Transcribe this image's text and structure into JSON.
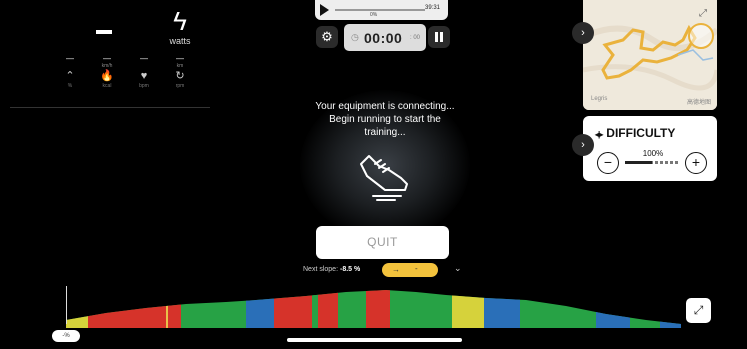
{
  "stats": {
    "big_value": "—",
    "watts_unit": "watts",
    "metrics": [
      {
        "value": "—",
        "sub": "",
        "icon": "⌃",
        "label": "%"
      },
      {
        "value": "—",
        "sub": "km/h",
        "icon": "🔥",
        "label": "kcal"
      },
      {
        "value": "—",
        "sub": "",
        "icon": "♥",
        "label": "bpm"
      },
      {
        "value": "—",
        "sub": "km",
        "icon": "↻",
        "label": "rpm"
      }
    ]
  },
  "player": {
    "percent": "0%",
    "total_time": "39:31"
  },
  "timer": {
    "time": "00:00",
    "fraction": ": 00"
  },
  "message": {
    "line1": "Your equipment is connecting...",
    "line2": "Begin running to start the",
    "line3": "training..."
  },
  "quit_label": "QUIT",
  "next_slope": {
    "label": "Next slope:",
    "value": "-8.5 %",
    "pill_arrow": "→",
    "pill_value": "-"
  },
  "map": {
    "logo_left": "Legris",
    "logo_right": "高德地图"
  },
  "difficulty": {
    "title": "DIFFICULTY",
    "value": "100%",
    "level": 0.5
  },
  "profile": {
    "current_slope": "-%",
    "segment_colors": [
      "#27a245",
      "#d6d23b",
      "#d6332a",
      "#2a6fb8",
      "#27a245",
      "#e8c14a"
    ]
  }
}
